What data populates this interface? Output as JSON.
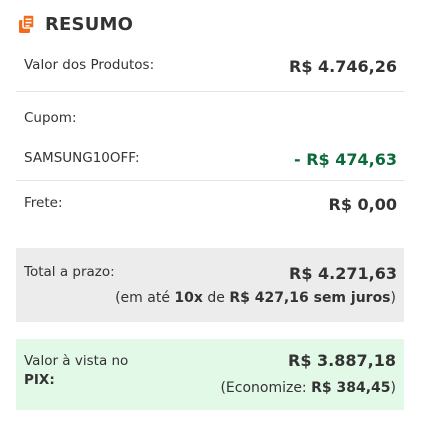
{
  "header": {
    "title": "RESUMO",
    "icon": "receipt-icon",
    "accent_color": "#f26b1d"
  },
  "products": {
    "label": "Valor dos Produtos:",
    "value": "R$ 4.746,26"
  },
  "coupon": {
    "label": "Cupom:",
    "code": "SAMSUNG10OFF:",
    "discount": "- R$ 474,63",
    "discount_color": "#0c6b3a"
  },
  "shipping": {
    "label": "Frete:",
    "value": "R$ 0,00"
  },
  "installments": {
    "label": "Total a prazo:",
    "value": "R$ 4.271,63",
    "detail_prefix": "(em até ",
    "detail_count": "10x",
    "detail_mid": " de ",
    "detail_amount": "R$ 427,16 sem juros",
    "detail_suffix": ")"
  },
  "pix": {
    "label_line1": "Valor à vista no",
    "label_line2": "PIX:",
    "value": "R$ 3.887,18",
    "savings_prefix": "(Economize: ",
    "savings_amount": "R$ 384,45",
    "savings_suffix": ")",
    "background": "#e3f9e8"
  }
}
